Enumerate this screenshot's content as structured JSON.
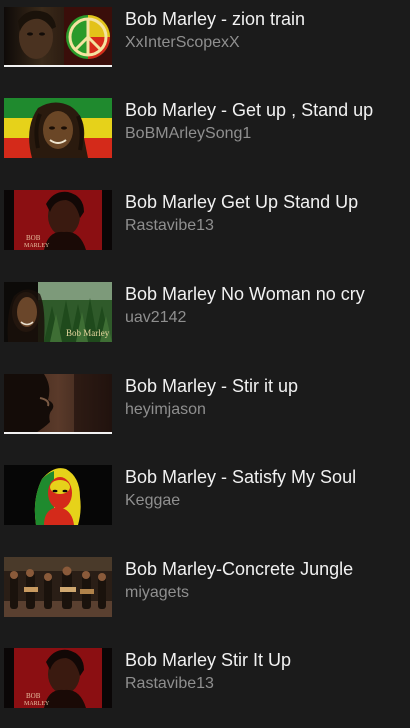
{
  "videos": [
    {
      "title": "Bob Marley - zion train",
      "channel": "XxInterScopexX",
      "thumbnail": "peace-sign-portrait",
      "watched": true
    },
    {
      "title": "Bob Marley - Get up , Stand up",
      "channel": "BoBMArleySong1",
      "thumbnail": "rasta-flag-portrait",
      "watched": false
    },
    {
      "title": "Bob Marley Get Up Stand Up",
      "channel": "Rastavibe13",
      "thumbnail": "album-cover-red",
      "watched": false
    },
    {
      "title": "Bob Marley No Woman no cry",
      "channel": "uav2142",
      "thumbnail": "forest-portrait",
      "watched": false
    },
    {
      "title": "Bob Marley - Stir it up",
      "channel": "heyimjason",
      "thumbnail": "dark-profile",
      "watched": true
    },
    {
      "title": "Bob Marley - Satisfy My Soul",
      "channel": "Keggae",
      "thumbnail": "rasta-silhouette",
      "watched": false
    },
    {
      "title": "Bob Marley-Concrete Jungle",
      "channel": "miyagets",
      "thumbnail": "live-band",
      "watched": false
    },
    {
      "title": "Bob Marley Stir It Up",
      "channel": "Rastavibe13",
      "thumbnail": "album-cover-red",
      "watched": false
    }
  ]
}
